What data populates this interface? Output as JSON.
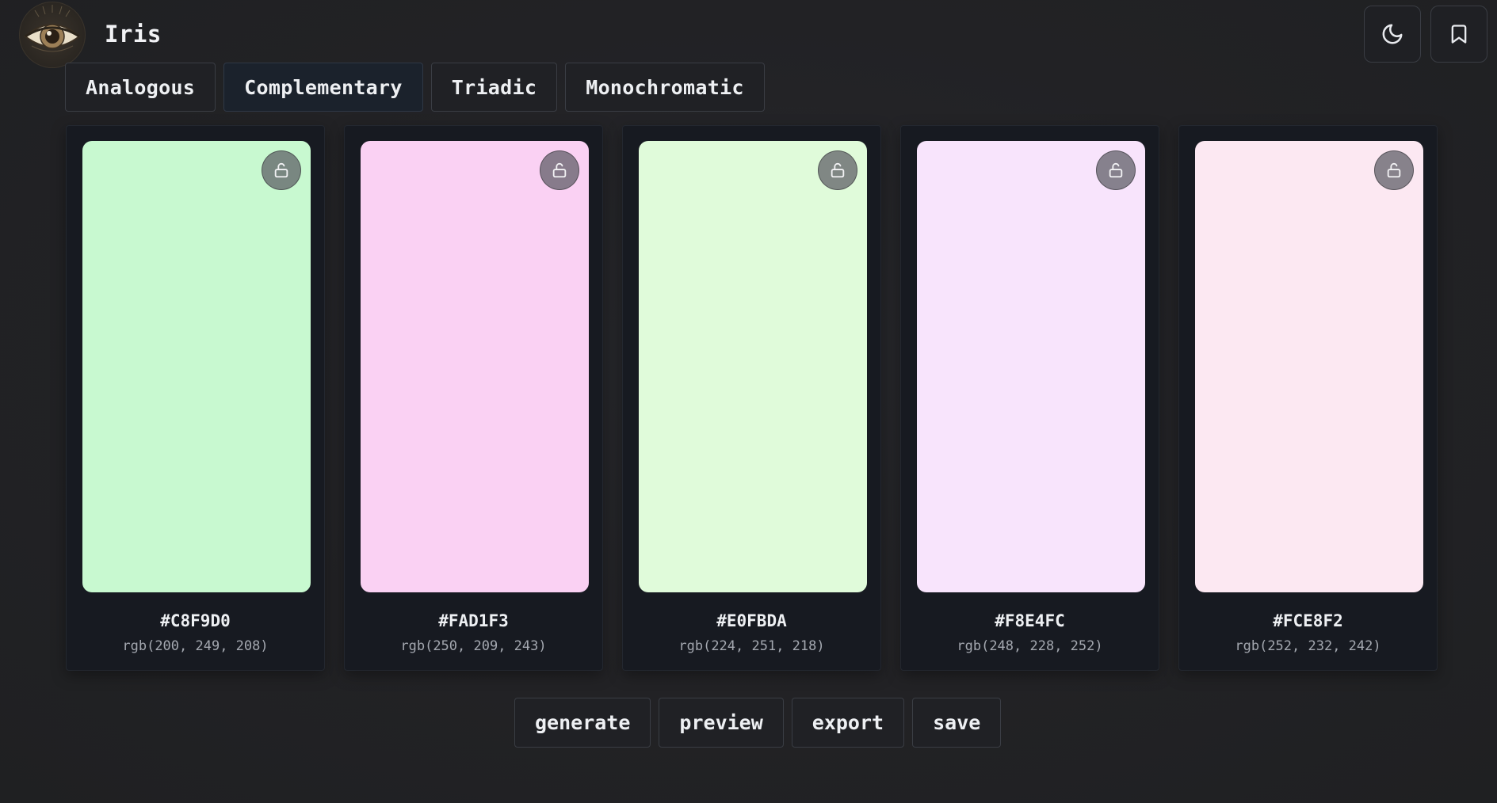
{
  "app": {
    "title": "Iris"
  },
  "header": {
    "theme_toggle_icon": "moon-icon",
    "bookmark_icon": "bookmark-icon"
  },
  "tabs": [
    {
      "label": "Analogous",
      "active": false
    },
    {
      "label": "Complementary",
      "active": true
    },
    {
      "label": "Triadic",
      "active": false
    },
    {
      "label": "Monochromatic",
      "active": false
    }
  ],
  "palette": [
    {
      "hex": "#C8F9D0",
      "rgb": "rgb(200, 249, 208)",
      "color": "#C8F9D0",
      "locked": false
    },
    {
      "hex": "#FAD1F3",
      "rgb": "rgb(250, 209, 243)",
      "color": "#FAD1F3",
      "locked": false
    },
    {
      "hex": "#E0FBDA",
      "rgb": "rgb(224, 251, 218)",
      "color": "#E0FBDA",
      "locked": false
    },
    {
      "hex": "#F8E4FC",
      "rgb": "rgb(248, 228, 252)",
      "color": "#F8E4FC",
      "locked": false
    },
    {
      "hex": "#FCE8F2",
      "rgb": "rgb(252, 232, 242)",
      "color": "#FCE8F2",
      "locked": false
    }
  ],
  "actions": {
    "generate": "generate",
    "preview": "preview",
    "export": "export",
    "save": "save"
  },
  "colors": {
    "background": "#222225",
    "card_background": "#171a21",
    "active_tab": "#1b222c",
    "lock_badge": "#5a5a62"
  }
}
